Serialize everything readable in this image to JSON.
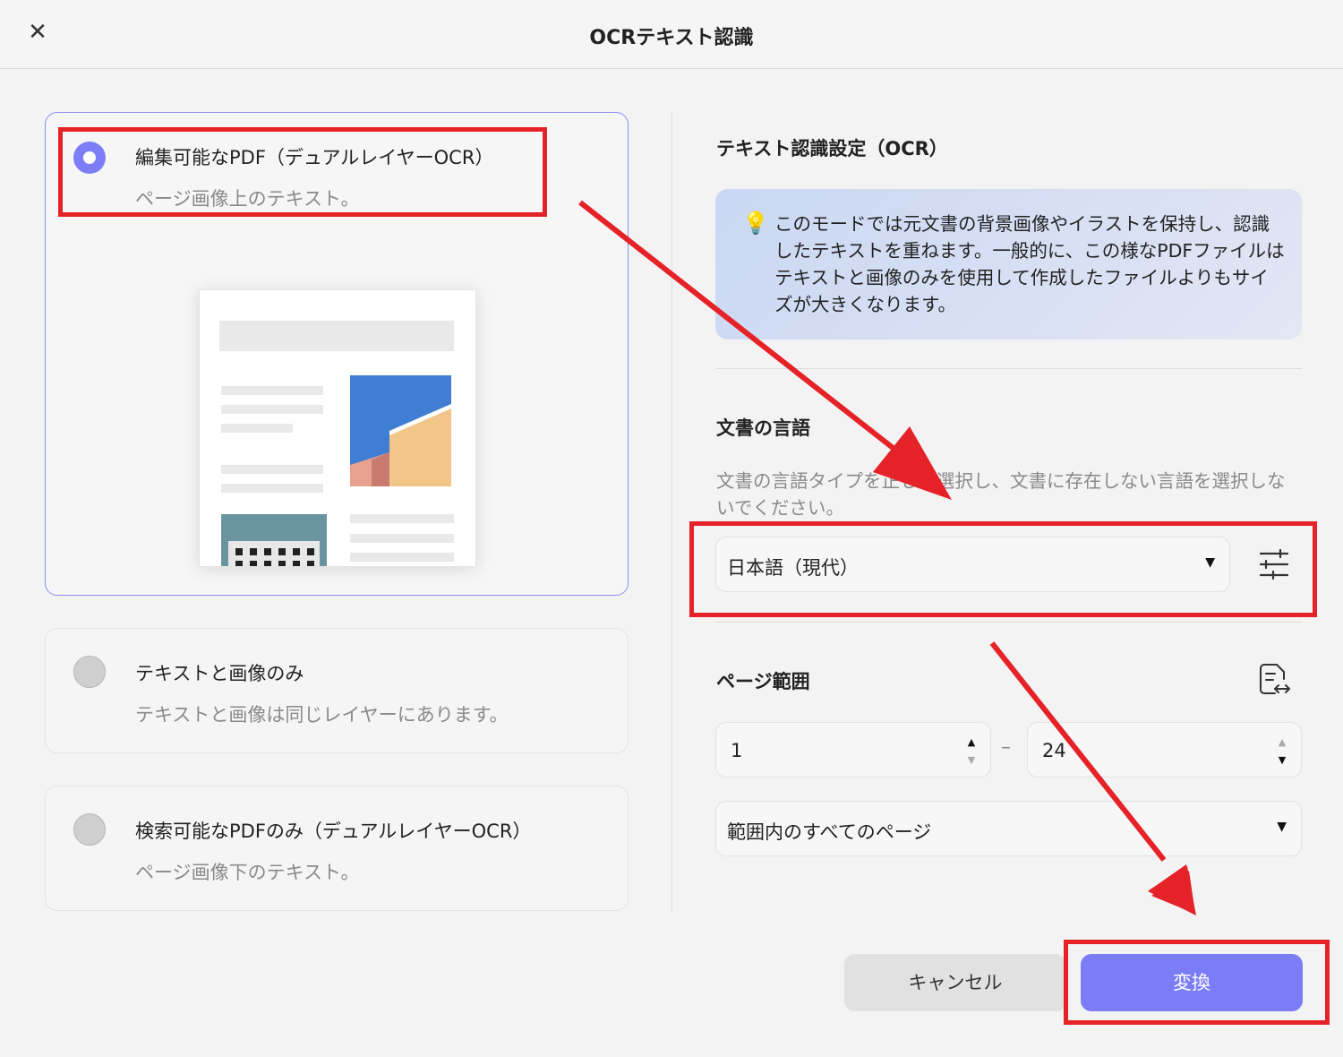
{
  "window": {
    "title": "OCRテキスト認識",
    "close_icon": "close-icon"
  },
  "modes": [
    {
      "title": "編集可能なPDF（デュアルレイヤーOCR）",
      "desc": "ページ画像上のテキスト。",
      "selected": true
    },
    {
      "title": "テキストと画像のみ",
      "desc": "テキストと画像は同じレイヤーにあります。",
      "selected": false
    },
    {
      "title": "検索可能なPDFのみ（デュアルレイヤーOCR）",
      "desc": "ページ画像下のテキスト。",
      "selected": false
    }
  ],
  "settings": {
    "title": "テキスト認識設定（OCR）",
    "info": "このモードでは元文書の背景画像やイラストを保持し、認識したテキストを重ねます。一般的に、この様なPDFファイルはテキストと画像のみを使用して作成したファイルよりもサイズが大きくなります。",
    "language_title": "文書の言語",
    "language_help": "文書の言語タイプを正しく選択し、文書に存在しない言語を選択しないでください。",
    "language_value": "日本語（現代）",
    "page_range_title": "ページ範囲",
    "page_from": "1",
    "page_to": "24",
    "range_value": "範囲内のすべてのページ"
  },
  "buttons": {
    "cancel": "キャンセル",
    "convert": "変換"
  },
  "colors": {
    "accent": "#7b7cf6",
    "highlight": "#e52228"
  }
}
